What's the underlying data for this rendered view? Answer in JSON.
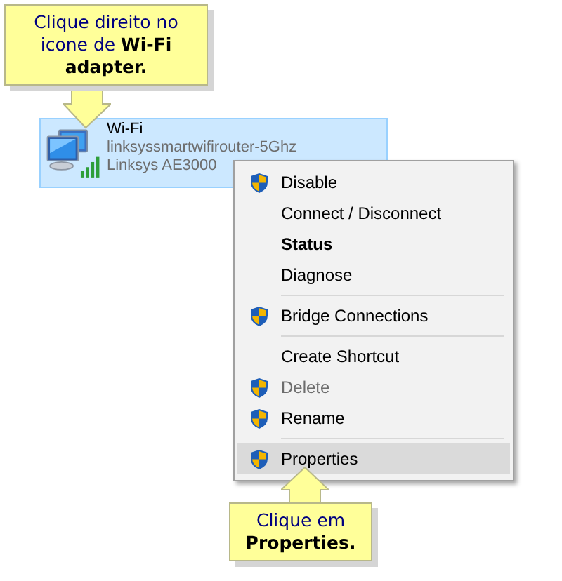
{
  "adapter": {
    "name": "Wi-Fi",
    "network": "linksyssmartwifirouter-5Ghz",
    "device": "Linksys AE3000",
    "selected": true
  },
  "context_menu": {
    "items": [
      {
        "kind": "item",
        "label": "Disable",
        "shield": true,
        "bold": false,
        "disabled": false,
        "selected": false
      },
      {
        "kind": "item",
        "label": "Connect / Disconnect",
        "shield": false,
        "bold": false,
        "disabled": false,
        "selected": false
      },
      {
        "kind": "item",
        "label": "Status",
        "shield": false,
        "bold": true,
        "disabled": false,
        "selected": false
      },
      {
        "kind": "item",
        "label": "Diagnose",
        "shield": false,
        "bold": false,
        "disabled": false,
        "selected": false
      },
      {
        "kind": "separator"
      },
      {
        "kind": "item",
        "label": "Bridge Connections",
        "shield": true,
        "bold": false,
        "disabled": false,
        "selected": false
      },
      {
        "kind": "separator"
      },
      {
        "kind": "item",
        "label": "Create Shortcut",
        "shield": false,
        "bold": false,
        "disabled": false,
        "selected": false
      },
      {
        "kind": "item",
        "label": "Delete",
        "shield": true,
        "bold": false,
        "disabled": true,
        "selected": false
      },
      {
        "kind": "item",
        "label": "Rename",
        "shield": true,
        "bold": false,
        "disabled": false,
        "selected": false
      },
      {
        "kind": "separator"
      },
      {
        "kind": "item",
        "label": "Properties",
        "shield": true,
        "bold": false,
        "disabled": false,
        "selected": true
      }
    ]
  },
  "callouts": [
    {
      "text": "Clique direito no icone de **Wi-Fi adapter.**"
    },
    {
      "text": "Clique em **Properties.**"
    }
  ]
}
